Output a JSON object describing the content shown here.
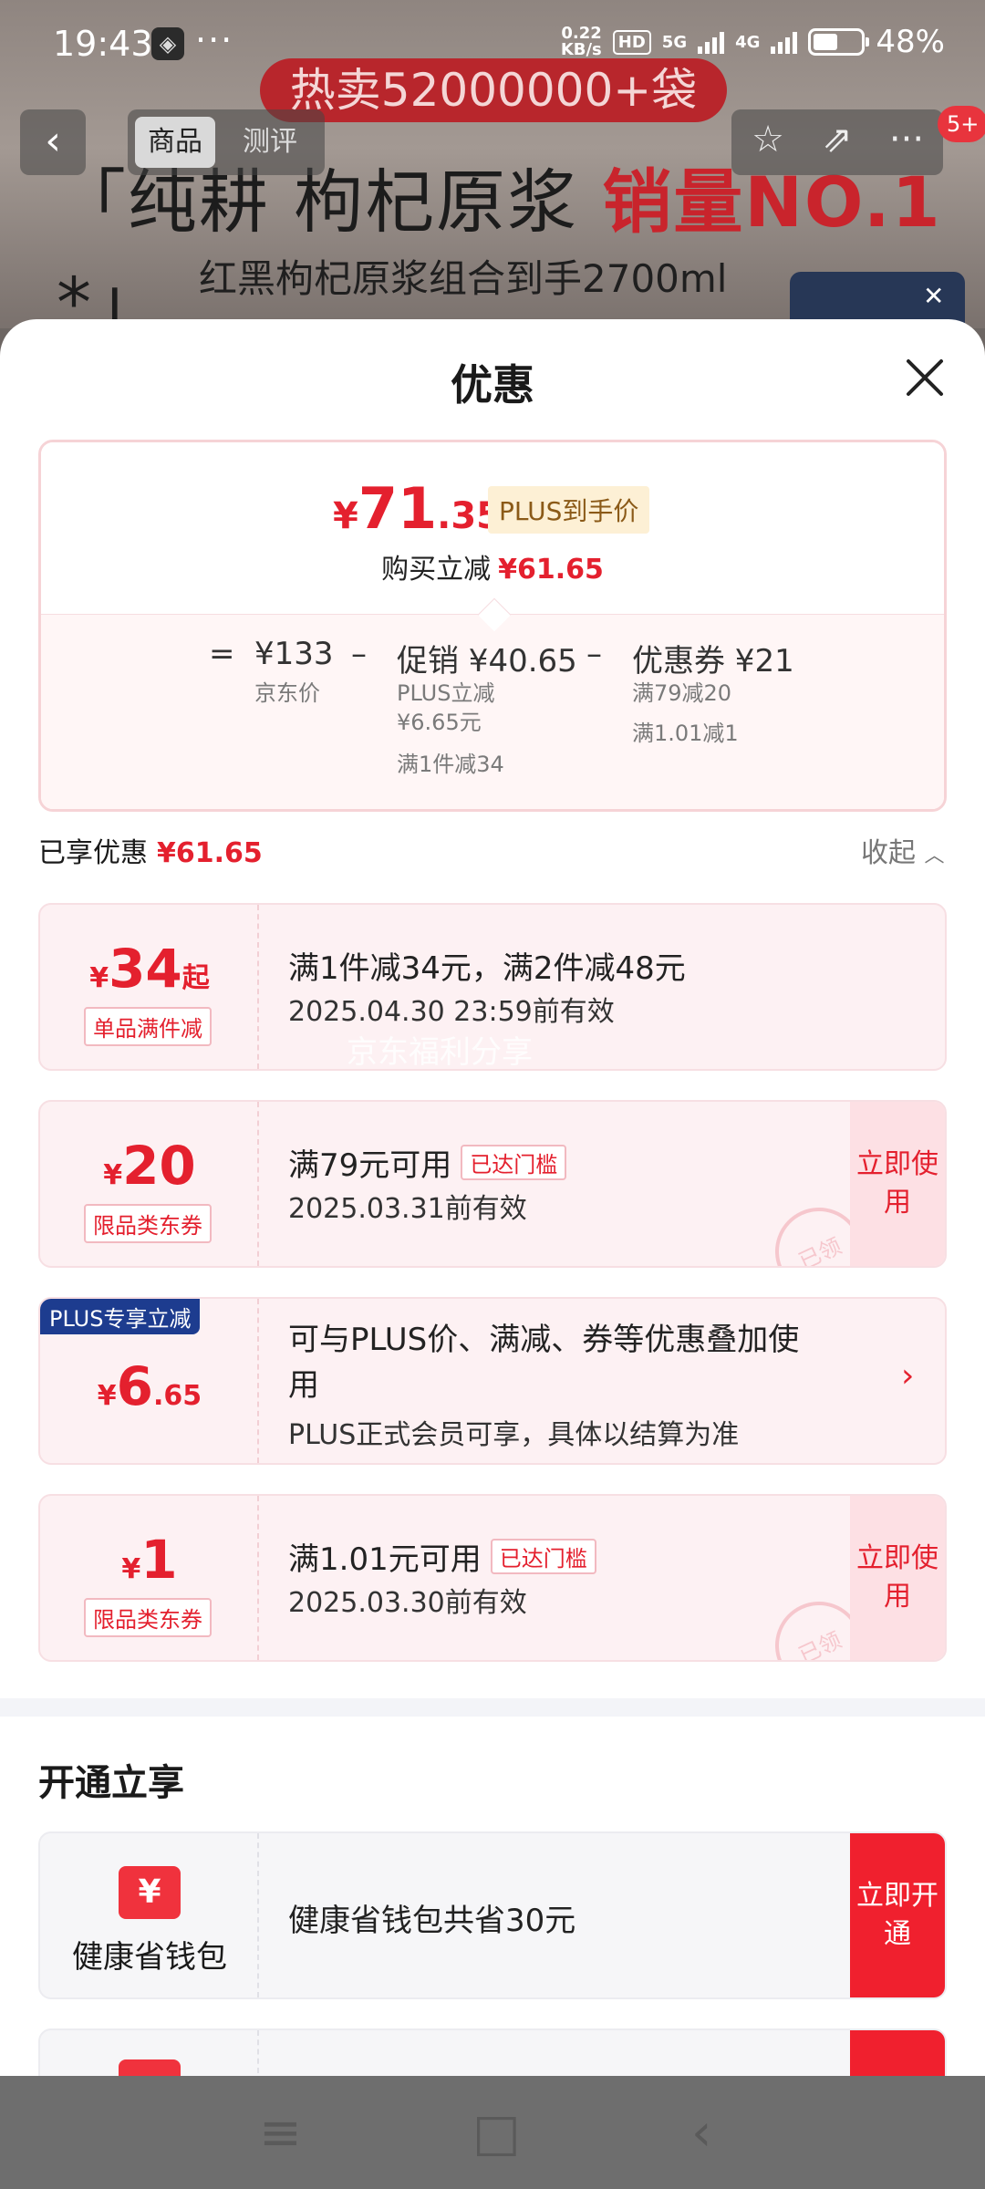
{
  "status_bar": {
    "time": "19:43",
    "speed_value": "0.22",
    "speed_unit": "KB/s",
    "hd": "HD",
    "net1": "5G",
    "net2": "4G",
    "battery": "48%"
  },
  "banner": {
    "hot_label": "热卖52000000+袋",
    "headline_prefix": "「纯耕 枸杞原浆 ",
    "headline_red": "销量NO.1",
    "headline_suffix": " *」",
    "subheadline": "红黑枸杞原浆组合到手2700ml"
  },
  "top_nav": {
    "tab_product": "商品",
    "tab_review": "测评",
    "badge": "5+"
  },
  "sheet": {
    "title": "优惠",
    "price": {
      "symbol": "¥",
      "integer": "71",
      "decimal": ".35",
      "plus_tag": "PLUS到手价",
      "reduce_label": "购买立减",
      "reduce_value": "¥61.65"
    },
    "formula": {
      "eq": "=",
      "jd_price": "¥133",
      "jd_label": "京东价",
      "minus1": "–",
      "promo": "促销 ¥40.65",
      "promo_sub1": "PLUS立减",
      "promo_sub2": "¥6.65元",
      "promo_sub3": "满1件减34",
      "minus2": "–",
      "coupon": "优惠券 ¥21",
      "coupon_sub1": "满79减20",
      "coupon_sub2": "满1.01减1"
    },
    "saved_label": "已享优惠",
    "saved_value": "¥61.65",
    "collapse_label": "收起",
    "coupons": [
      {
        "symbol": "¥",
        "amount": "34",
        "suffix": "起",
        "tag": "单品满件减",
        "title": "满1件减34元，满2件减48元",
        "sub": "2025.04.30 23:59前有效"
      },
      {
        "symbol": "¥",
        "amount": "20",
        "tag": "限品类东券",
        "title": "满79元可用",
        "reached": "已达门槛",
        "sub": "2025.03.31前有效",
        "button": "立即使用",
        "stamp": "已领"
      },
      {
        "flag": "PLUS专享立减",
        "symbol": "¥",
        "amount": "6",
        "decimal": ".65",
        "title_line1": "可与PLUS价、满减、券等优惠叠加使",
        "title_line2": "用",
        "sub": "PLUS正式会员可享，具体以结算为准"
      },
      {
        "symbol": "¥",
        "amount": "1",
        "tag": "限品类东券",
        "title": "满1.01元可用",
        "reached": "已达门槛",
        "sub": "2025.03.30前有效",
        "button": "立即使用",
        "stamp": "已领"
      }
    ],
    "watermark": "京东福利分享",
    "open_section": {
      "title": "开通立享",
      "wallet_name": "健康省钱包",
      "wallet_icon": "¥",
      "wallet_text": "健康省钱包共省30元",
      "button": "立即开通"
    }
  },
  "colors": {
    "accent": "#e4202e",
    "plus_blue": "#1d3c8f",
    "coupon_bg": "#fdf1f3"
  }
}
